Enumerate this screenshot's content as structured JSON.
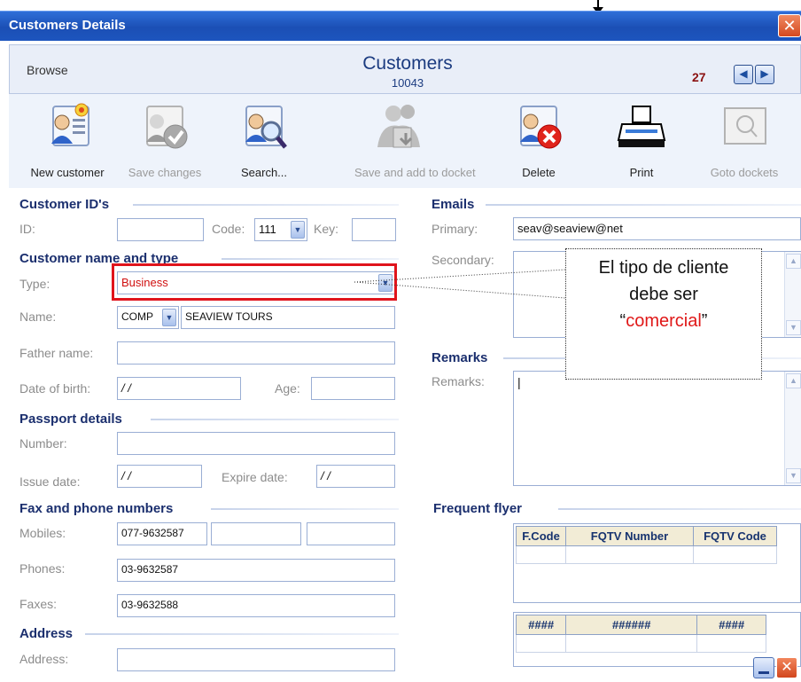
{
  "window": {
    "title": "Customers Details",
    "close_glyph": "✕"
  },
  "header": {
    "mode": "Browse",
    "title": "Customers",
    "code": "10043",
    "record_count": "27",
    "prev_glyph": "◀",
    "next_glyph": "▶"
  },
  "toolbar": [
    {
      "label": "New customer",
      "icon": "new-customer-icon",
      "enabled": true
    },
    {
      "label": "Save changes",
      "icon": "save-changes-icon",
      "enabled": false
    },
    {
      "label": "Search...",
      "icon": "search-customer-icon",
      "enabled": true
    },
    {
      "label": "Save and add to docket",
      "icon": "save-add-docket-icon",
      "enabled": false
    },
    {
      "label": "Delete",
      "icon": "delete-customer-icon",
      "enabled": true
    },
    {
      "label": "Print",
      "icon": "printer-icon",
      "enabled": true
    },
    {
      "label": "Goto dockets",
      "icon": "goto-dockets-icon",
      "enabled": false
    }
  ],
  "ids": {
    "section": "Customer ID's",
    "id_label": "ID:",
    "id_value": "",
    "code_label": "Code:",
    "code_value": "111",
    "key_label": "Key:",
    "key_value": ""
  },
  "name_type": {
    "section": "Customer name and type",
    "type_label": "Type:",
    "type_value": "Business",
    "name_label": "Name:",
    "name_prefix": "COMP",
    "name_value": "SEAVIEW TOURS",
    "father_label": "Father name:",
    "father_value": "",
    "dob_label": "Date of birth:",
    "dob_value": "/ /",
    "age_label": "Age:",
    "age_value": ""
  },
  "passport": {
    "section": "Passport details",
    "number_label": "Number:",
    "number_value": "",
    "issue_label": "Issue date:",
    "issue_value": "/ /",
    "expire_label": "Expire date:",
    "expire_value": "/ /"
  },
  "phones": {
    "section": "Fax and phone numbers",
    "mobiles_label": "Mobiles:",
    "mobile1": "077-9632587",
    "phones_label": "Phones:",
    "phone1": "03-9632587",
    "faxes_label": "Faxes:",
    "fax1": "03-9632588"
  },
  "address": {
    "section": "Address",
    "label": "Address:",
    "value": ""
  },
  "emails": {
    "section": "Emails",
    "primary_label": "Primary:",
    "primary_value": "seav@seaview@net",
    "secondary_label": "Secondary:"
  },
  "remarks": {
    "section": "Remarks",
    "label": "Remarks:",
    "value": "|"
  },
  "flyer": {
    "section": "Frequent flyer",
    "columns": [
      "F.Code",
      "FQTV Number",
      "FQTV Code"
    ],
    "columns2": [
      "####",
      "######",
      "####"
    ]
  },
  "callout": {
    "line1": "El tipo de cliente",
    "line2": "debe ser",
    "open_quote": "“",
    "highlight": "comercial",
    "close_quote": "”"
  },
  "colors": {
    "titlebar": "#1b4fb5",
    "section": "#1b2f6e",
    "highlight": "#e0141c",
    "count": "#8a1010"
  }
}
